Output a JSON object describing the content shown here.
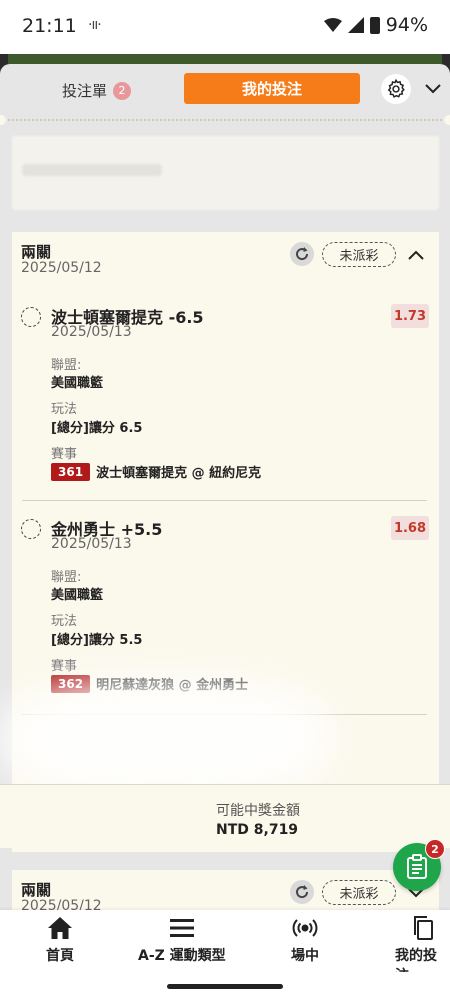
{
  "status_bar": {
    "time": "21:11",
    "vibrate_glyph": "·ıı·",
    "battery": "94%"
  },
  "header": {
    "betslip_label": "投注單",
    "betslip_count": "2",
    "mybets_label": "我的投注",
    "icons": [
      "gear-icon",
      "chevron-down-icon"
    ]
  },
  "bet": {
    "title": "兩關",
    "date": "2025/05/12",
    "status": "未派彩",
    "legs": [
      {
        "selection": "波士頓塞爾提克 -6.5",
        "odds": "1.73",
        "date": "2025/05/13",
        "league_label": "聯盟:",
        "league": "美國職籃",
        "market_label": "玩法",
        "market": "[總分]讓分 6.5",
        "event_label": "賽事",
        "event_no": "361",
        "event": "波士頓塞爾提克 @ 紐約尼克"
      },
      {
        "selection": "金州勇士 +5.5",
        "odds": "1.68",
        "date": "2025/05/13",
        "league_label": "聯盟:",
        "league": "美國職籃",
        "market_label": "玩法",
        "market": "[總分]讓分 5.5",
        "event_label": "賽事",
        "event_no": "362",
        "event": "明尼蘇達灰狼 @ 金州勇士"
      }
    ],
    "payout_label": "可能中獎金額",
    "payout_value": "NTD 8,719"
  },
  "bet2": {
    "title": "兩關",
    "date": "2025/05/12",
    "status": "未派彩"
  },
  "fab": {
    "badge": "2"
  },
  "nav": [
    {
      "label": "首頁",
      "icon": "home-icon"
    },
    {
      "label": "A-Z 運動類型",
      "icon": "menu-icon"
    },
    {
      "label": "場中",
      "icon": "live-icon"
    },
    {
      "label": "我的投注",
      "icon": "copy-icon"
    }
  ],
  "colors": {
    "accent": "#f57c19",
    "odds_text": "#c0392b",
    "event_badge": "#b01a1a",
    "fab": "#1fa64a"
  }
}
